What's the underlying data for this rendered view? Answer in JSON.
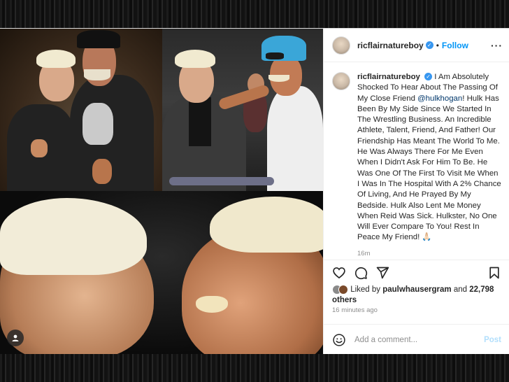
{
  "post": {
    "username": "ricflairnatureboy",
    "verified_mark": "✓",
    "separator": "•",
    "follow_label": "Follow",
    "more_label": "···",
    "caption_text": "I Am Absolutely Shocked To Hear About The Passing Of My Close Friend ",
    "mention": "@hulkhogan",
    "caption_rest": "! Hulk Has Been By My Side Since We Started In The Wrestling Business. An Incredible Athlete, Talent, Friend, And Father! Our Friendship Has Meant The World To Me. He Was Always There For Me Even When I Didn't Ask For Him To Be. He Was One Of The First To Visit Me When I Was In The Hospital With A 2% Chance Of Living, And He Prayed By My Bedside. Hulk Also Lent Me Money When Reid Was Sick. Hulkster, No One Will Ever Compare To You! Rest In Peace My Friend! 🙏🏻",
    "caption_age": "16m",
    "likes_prefix": "Liked by ",
    "likes_user": "paulwhausergram",
    "likes_middle": " and ",
    "likes_count": "22,798 others",
    "post_time": "16 minutes ago",
    "comment_placeholder": "Add a comment...",
    "post_label": "Post"
  },
  "icons": {
    "like": "heart-icon",
    "comment": "comment-icon",
    "share": "share-icon",
    "save": "bookmark-icon",
    "emoji": "emoji-icon",
    "tags": "user-tag-icon"
  },
  "colors": {
    "accent": "#0095f6",
    "verified": "#3897f0",
    "post_disabled": "#b2dffc"
  }
}
